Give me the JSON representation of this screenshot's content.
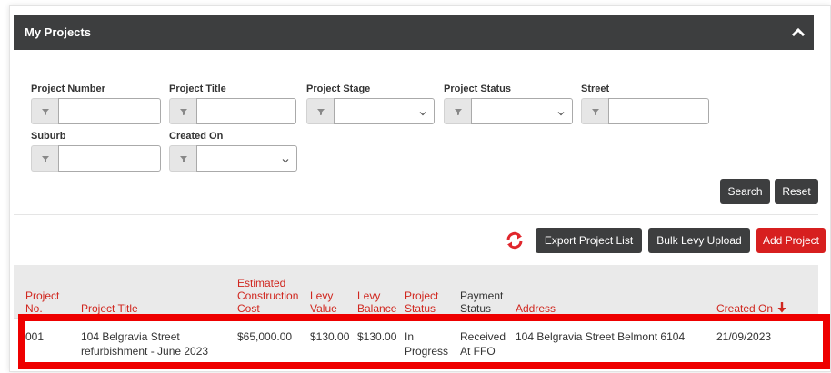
{
  "header": {
    "title": "My Projects",
    "collapse_icon": "chevron-up-icon"
  },
  "filters": {
    "project_number_label": "Project Number",
    "project_title_label": "Project Title",
    "project_stage_label": "Project Stage",
    "project_status_label": "Project Status",
    "street_label": "Street",
    "suburb_label": "Suburb",
    "created_on_label": "Created On",
    "filter_icon": "filter-icon"
  },
  "actions": {
    "search_label": "Search",
    "reset_label": "Reset",
    "export_label": "Export Project List",
    "bulk_levy_label": "Bulk Levy Upload",
    "add_project_label": "Add Project",
    "refresh_icon": "refresh-icon"
  },
  "table": {
    "columns": {
      "project_no": [
        "Project",
        "No."
      ],
      "project_title": [
        "Project Title"
      ],
      "est_cost": [
        "Estimated",
        "Construction",
        "Cost"
      ],
      "levy_value": [
        "Levy",
        "Value"
      ],
      "levy_balance": [
        "Levy",
        "Balance"
      ],
      "project_status": [
        "Project",
        "Status"
      ],
      "payment_status": [
        "Payment",
        "Status"
      ],
      "address": [
        "Address"
      ],
      "created_on": [
        "Created On"
      ]
    },
    "sort_icon": "sort-down-arrow-icon",
    "rows": [
      {
        "project_no": "001",
        "project_title": [
          "104 Belgravia Street",
          "refurbishment - June 2023"
        ],
        "est_cost": "$65,000.00",
        "levy_value": "$130.00",
        "levy_balance": "$130.00",
        "project_status": [
          "In",
          "Progress"
        ],
        "payment_status": [
          "Received",
          "At FFO"
        ],
        "address": "104 Belgravia Street Belmont 6104",
        "created_on": "21/09/2023"
      }
    ]
  },
  "colors": {
    "header_bg": "#3d3e3f",
    "accent_red": "#d71f1f",
    "column_header_text": "#d0271f",
    "highlight_border": "#ee0000"
  }
}
